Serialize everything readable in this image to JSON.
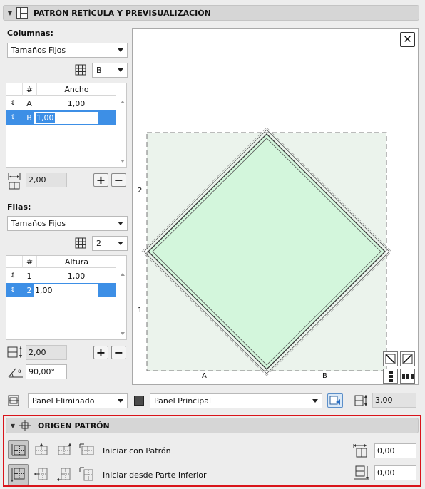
{
  "section1": {
    "title": "PATRÓN RETÍCULA Y PREVISUALIZACIÓN"
  },
  "columns": {
    "label": "Columnas:",
    "mode_value": "Tamaños Fijos",
    "count_value": "B",
    "table": {
      "headers": [
        "#",
        "Ancho"
      ],
      "rows": [
        {
          "id": "A",
          "value": "1,00"
        },
        {
          "id": "B",
          "value": "1,00"
        }
      ]
    },
    "total_value": "2,00",
    "add_label": "+",
    "remove_label": "−"
  },
  "rows_section": {
    "label": "Filas:",
    "mode_value": "Tamaños Fijos",
    "count_value": "2",
    "table": {
      "headers": [
        "#",
        "Altura"
      ],
      "rows": [
        {
          "id": "1",
          "value": "1,00"
        },
        {
          "id": "2",
          "value": "1,00"
        }
      ]
    },
    "total_value": "2,00",
    "angle_value": "90,00°",
    "add_label": "+",
    "remove_label": "−"
  },
  "preview": {
    "close_label": "✕",
    "row_labels": [
      "2",
      "1"
    ],
    "col_labels": [
      "A",
      "B"
    ],
    "fill_color": "#d3f6dc",
    "outline_color": "#3a3a3a"
  },
  "bottom_bar": {
    "panel_removed_value": "Panel Eliminado",
    "panel_main_value": "Panel Principal",
    "height_value": "3,00"
  },
  "section2": {
    "title": "ORIGEN PATRÓN",
    "start_pattern_label": "Iniciar con Patrón",
    "start_bottom_label": "Iniciar desde Parte Inferior",
    "offset_x_value": "0,00",
    "offset_y_value": "0,00"
  },
  "colors": {
    "selection": "#3d8fe6",
    "highlight_border": "#d9141b"
  }
}
